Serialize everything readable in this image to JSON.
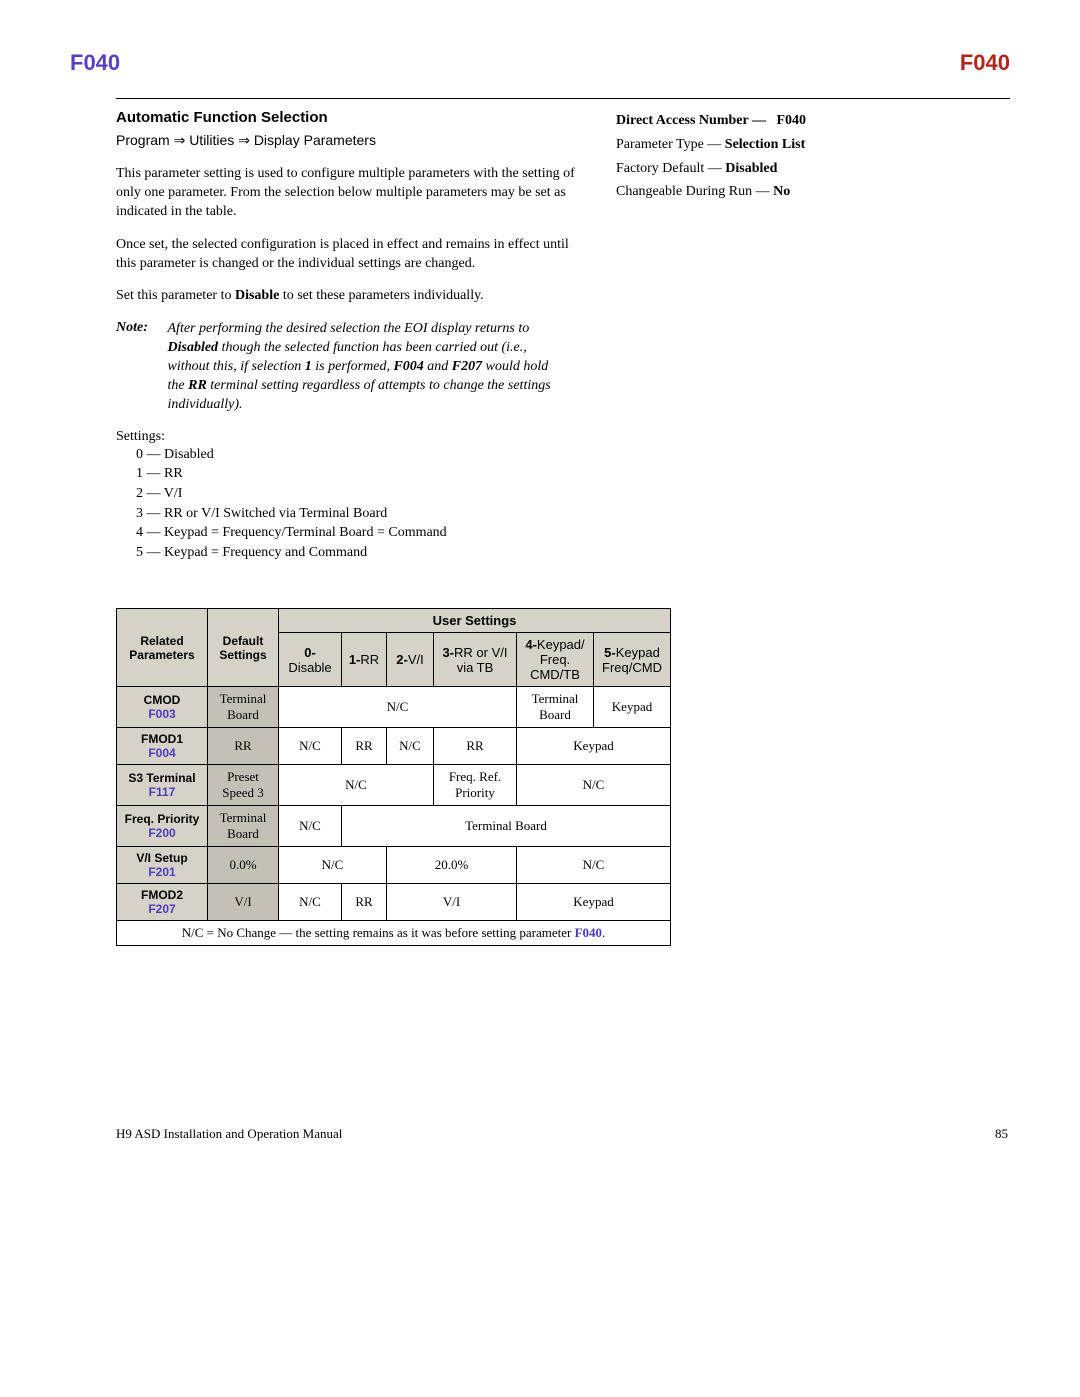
{
  "header": {
    "left": "F040",
    "right": "F040"
  },
  "main": {
    "title": "Automatic Function Selection",
    "breadcrumb": "Program ⇒ Utilities ⇒ Display Parameters",
    "para1": "This parameter setting is used to configure multiple parameters with the setting of only one parameter. From the selection below multiple parameters may be set as indicated in the table.",
    "para2": "Once set, the selected configuration is placed in effect and remains in effect until this parameter is changed or the individual settings are changed.",
    "para3_pre": "Set this parameter to ",
    "para3_bold": "Disable",
    "para3_post": " to set these parameters individually.",
    "note_label": "Note:",
    "note_text_1": "After performing the desired selection the EOI display returns to ",
    "note_bold_1": "Disabled",
    "note_text_2": " though the selected function has been carried out (i.e., without this, if selection ",
    "note_bold_2": "1",
    "note_text_3": " is performed, ",
    "note_bold_3": "F004",
    "note_text_4": " and ",
    "note_bold_4": "F207",
    "note_text_5": " would hold the ",
    "note_bold_5": "RR",
    "note_text_6": " terminal setting regardless of attempts to change the settings individually).",
    "settings_label": "Settings:",
    "settings": [
      "0 — Disabled",
      "1 — RR",
      "2 — V/I",
      "3 — RR or V/I Switched via Terminal Board",
      "4 — Keypad = Frequency/Terminal Board = Command",
      "5 — Keypad = Frequency and Command"
    ]
  },
  "side": {
    "dan_label": "Direct Access Number —",
    "dan_value": "F040",
    "ptype_label": "Parameter Type — ",
    "ptype_value": "Selection List",
    "default_label": "Factory Default — ",
    "default_value": "Disabled",
    "change_label": "Changeable During Run — ",
    "change_value": "No"
  },
  "table": {
    "user_settings": "User Settings",
    "col_related": "Related Parameters",
    "col_default": "Default Settings",
    "c0b": "0-",
    "c0t": "Disable",
    "c1b": "1-",
    "c1t": "RR",
    "c2b": "2-",
    "c2t": "V/I",
    "c3b": "3-",
    "c3t": "RR or V/I via TB",
    "c4b": "4-",
    "c4t": "Keypad/ Freq. CMD/TB",
    "c5b": "5-",
    "c5t": "Keypad Freq/CMD",
    "rows": [
      {
        "name": "CMOD",
        "link": "F003",
        "default": "Terminal Board",
        "cells": [
          "N/C",
          "",
          "",
          "",
          "Terminal Board",
          "Keypad"
        ]
      },
      {
        "name": "FMOD1",
        "link": "F004",
        "default": "RR",
        "cells": [
          "N/C",
          "RR",
          "N/C",
          "RR",
          "Keypad",
          ""
        ]
      },
      {
        "name": "S3 Terminal",
        "link": "F117",
        "default": "Preset Speed 3",
        "cells": [
          "N/C",
          "",
          "",
          "Freq. Ref. Priority",
          "N/C",
          ""
        ]
      },
      {
        "name": "Freq. Priority",
        "link": "F200",
        "default": "Terminal Board",
        "cells": [
          "N/C",
          "Terminal Board",
          "",
          "",
          "",
          ""
        ]
      },
      {
        "name": "V/I Setup",
        "link": "F201",
        "default": "0.0%",
        "cells": [
          "N/C",
          "",
          "20.0%",
          "",
          "N/C",
          ""
        ]
      },
      {
        "name": "FMOD2",
        "link": "F207",
        "default": "V/I",
        "cells": [
          "N/C",
          "RR",
          "V/I",
          "",
          "Keypad",
          ""
        ]
      }
    ],
    "footnote_pre": "N/C = No Change — the setting remains as it was before setting parameter ",
    "footnote_link": "F040",
    "footnote_post": "."
  },
  "footer": {
    "left": "H9 ASD Installation and Operation Manual",
    "right": "85"
  }
}
